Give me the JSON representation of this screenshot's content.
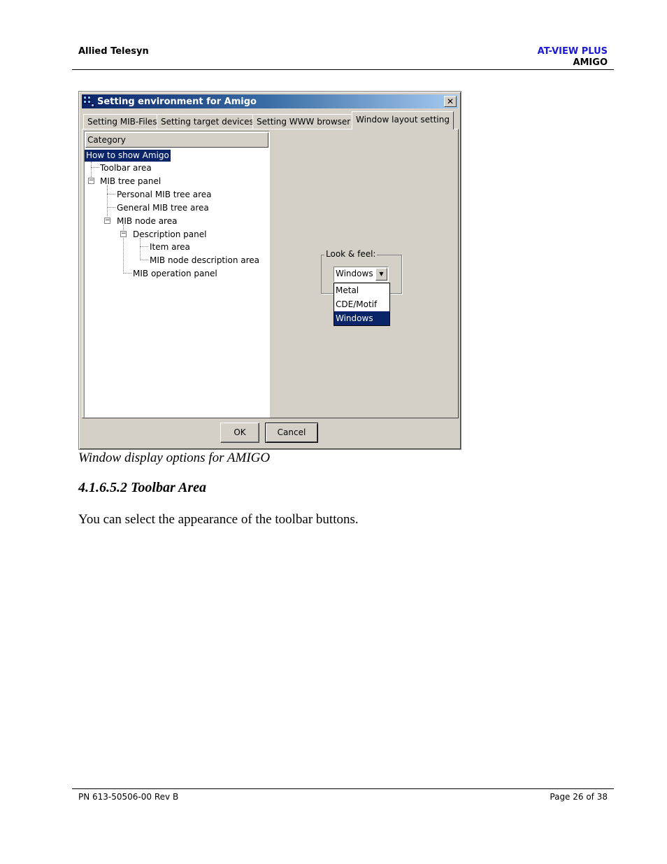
{
  "header": {
    "company": "Allied Telesyn",
    "product": "AT-VIEW PLUS",
    "module": "AMIGO",
    "product_color": "#1a1ad6"
  },
  "dialog": {
    "title": "Setting environment for Amigo",
    "close_glyph": "✕",
    "tabs": [
      "Setting MIB-Files",
      "Setting target devices",
      "Setting WWW browser",
      "Window layout setting"
    ],
    "active_tab": "Window layout setting",
    "category_header": "Category",
    "tree": [
      {
        "label": "How to show Amigo",
        "selected": true
      },
      {
        "label": "Toolbar area"
      },
      {
        "label": "MIB tree panel",
        "expanded": true
      },
      {
        "label": "Personal MIB tree area"
      },
      {
        "label": "General MIB tree area"
      },
      {
        "label": "MIB node area",
        "expanded": true
      },
      {
        "label": "Description panel",
        "expanded": true
      },
      {
        "label": "Item area"
      },
      {
        "label": "MIB node description area"
      },
      {
        "label": "MIB operation panel"
      }
    ],
    "look_feel": {
      "label": "Look & feel:",
      "selected": "Windows",
      "options": [
        "Metal",
        "CDE/Motif",
        "Windows"
      ]
    },
    "ok_label": "OK",
    "cancel_label": "Cancel",
    "icons": [
      "app-icon",
      "close-icon",
      "chevron-down-icon",
      "expander-minus-icon"
    ]
  },
  "caption": "Window display options for AMIGO",
  "section_heading": "4.1.6.5.2 Toolbar Area",
  "body_text": "You can select the appearance of the toolbar buttons.",
  "footer": {
    "part_number": "PN 613-50506-00 Rev B",
    "page": "Page 26 of 38"
  }
}
